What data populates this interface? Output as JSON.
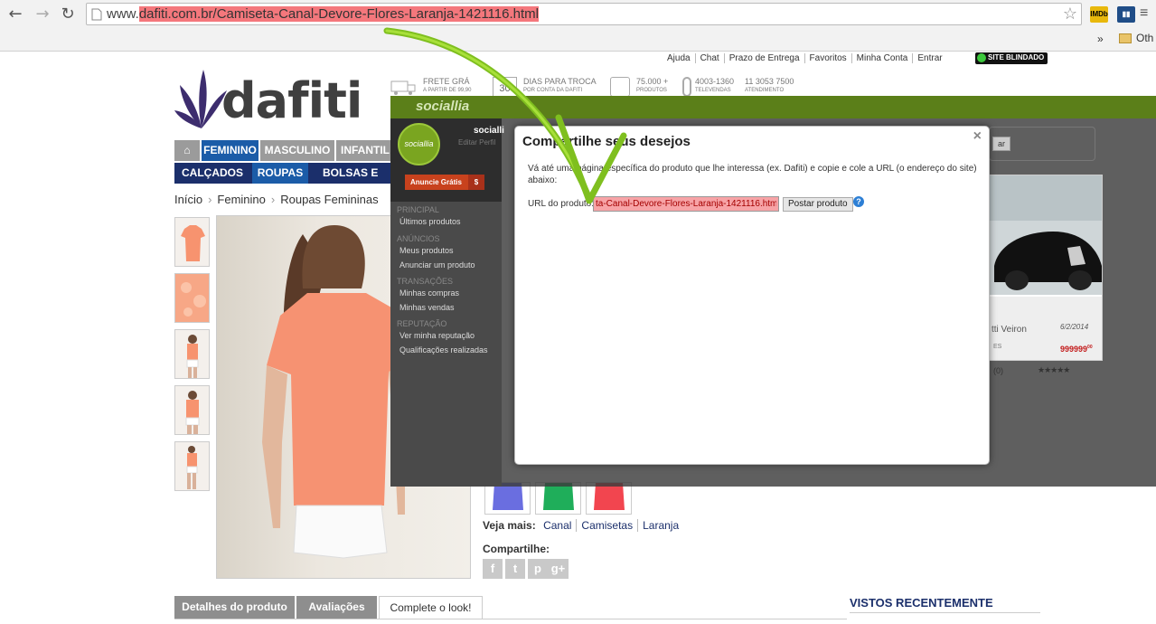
{
  "browser": {
    "url_prefix": "www.",
    "url_domain": "dafiti.com.br",
    "url_path": "/Camiseta-Canal-Devore-Flores-Laranja-1421116.html",
    "bookmarks_more": "»",
    "bookmarks_other": "Oth"
  },
  "site": {
    "logo_text": "dafiti",
    "top_links": [
      "Ajuda",
      "Chat",
      "Prazo de Entrega",
      "Favoritos",
      "Minha Conta",
      "Entrar"
    ],
    "site_blindado": "SITE BLINDADO",
    "features": [
      {
        "title": "FRETE GRÁ",
        "sub": "A PARTIR DE 99,90"
      },
      {
        "title": "DIAS PARA TROCA",
        "sub": "POR CONTA DA DAFITI",
        "num": "30"
      },
      {
        "title": "75.000 +",
        "sub": "PRODUTOS"
      },
      {
        "title": "4003-1360",
        "sub": "TELEVENDAS"
      },
      {
        "title": "11 3053 7500",
        "sub": "ATENDIMENTO"
      }
    ],
    "main_nav": [
      "FEMININO",
      "MASCULINO",
      "INFANTIL"
    ],
    "sub_nav": [
      "CALÇADOS",
      "ROUPAS",
      "BOLSAS E ACE"
    ],
    "breadcrumb": [
      "Início",
      "Feminino",
      "Roupas Femininas"
    ],
    "veja_mais_label": "Veja mais:",
    "veja_mais_links": [
      "Canal",
      "Camisetas",
      "Laranja"
    ],
    "compartilhe": "Compartilhe:",
    "tabs": [
      "Detalhes do produto",
      "Avaliações",
      "Complete o look!"
    ],
    "vistos": "VISTOS RECENTEMENTE"
  },
  "overlay": {
    "logo": "sociallia",
    "user_name": "socialli",
    "edit_profile": "Editar Perfil",
    "avatar_text": "sociallia",
    "anuncie": "Anuncie Grátis",
    "anuncie_icon": "$",
    "menu": [
      {
        "header": "PRINCIPAL",
        "items": [
          "Últimos produtos"
        ]
      },
      {
        "header": "ANÚNCIOS",
        "items": [
          "Meus produtos",
          "Anunciar um produto"
        ]
      },
      {
        "header": "TRANSAÇÕES",
        "items": [
          "Minhas compras",
          "Minhas vendas"
        ]
      },
      {
        "header": "REPUTAÇÃO",
        "items": [
          "Ver minha reputação",
          "Qualificações realizadas"
        ]
      }
    ]
  },
  "modal": {
    "title": "Compartilhe seus desejos",
    "close": "×",
    "description": "Vá até uma página específica do produto que lhe interessa (ex. Dafiti) e copie e cole a URL (o endereço do site) abaixo:",
    "url_label": "URL do produto:",
    "url_value": "ta-Canal-Devore-Flores-Laranja-1421116.html",
    "post_button": "Postar produto",
    "help": "?"
  },
  "car_card": {
    "title": "tti Veiron",
    "date": "6/2/2014",
    "location": "ES",
    "price": "999999",
    "price_cents": "00",
    "rating_count": "(0)",
    "stars": "★★★★★",
    "search_btn": "ar"
  }
}
